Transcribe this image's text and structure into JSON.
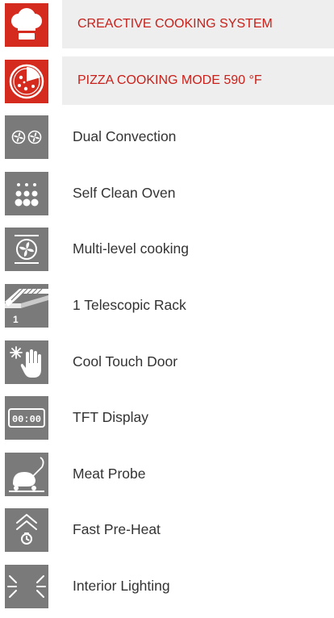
{
  "features": [
    {
      "label": "CREACTIVE COOKING SYSTEM",
      "icon": "chef-hat-icon",
      "highlight": true,
      "icon_color": "#d52b1e"
    },
    {
      "label": "PIZZA COOKING MODE 590 °F",
      "icon": "pizza-icon",
      "highlight": true,
      "icon_color": "#d52b1e"
    },
    {
      "label": "Dual Convection",
      "icon": "dual-fan-icon",
      "highlight": false,
      "icon_color": "#7a7a7a"
    },
    {
      "label": "Self Clean Oven",
      "icon": "self-clean-dots-icon",
      "highlight": false,
      "icon_color": "#7a7a7a"
    },
    {
      "label": "Multi-level cooking",
      "icon": "multi-level-fan-icon",
      "highlight": false,
      "icon_color": "#7a7a7a"
    },
    {
      "label": "1 Telescopic Rack",
      "icon": "telescopic-rack-icon",
      "icon_text": "1",
      "highlight": false,
      "icon_color": "#7a7a7a"
    },
    {
      "label": "Cool Touch Door",
      "icon": "cool-touch-hand-icon",
      "highlight": false,
      "icon_color": "#7a7a7a"
    },
    {
      "label": "TFT Display",
      "icon": "tft-display-icon",
      "icon_text": "00:00",
      "highlight": false,
      "icon_color": "#7a7a7a"
    },
    {
      "label": "Meat Probe",
      "icon": "meat-probe-icon",
      "highlight": false,
      "icon_color": "#7a7a7a"
    },
    {
      "label": "Fast Pre-Heat",
      "icon": "fast-preheat-icon",
      "highlight": false,
      "icon_color": "#7a7a7a"
    },
    {
      "label": "Interior Lighting",
      "icon": "interior-lighting-icon",
      "highlight": false,
      "icon_color": "#7a7a7a"
    }
  ],
  "colors": {
    "accent": "#c8201a",
    "highlight_bg": "#eeeeee",
    "icon_grey": "#7a7a7a",
    "text": "#333333"
  }
}
